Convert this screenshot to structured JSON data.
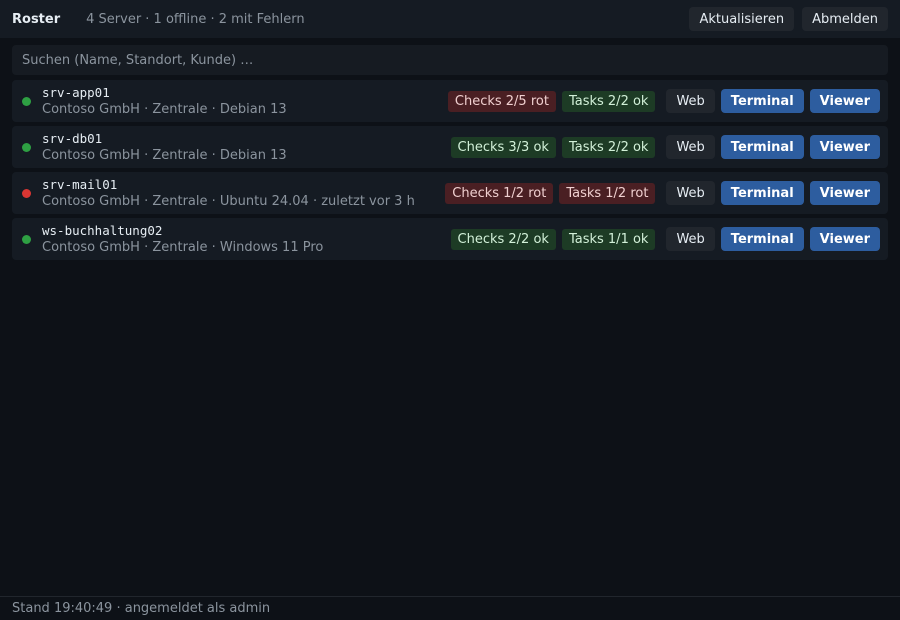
{
  "header": {
    "title": "Roster",
    "summary": "4 Server · 1 offline · 2 mit Fehlern",
    "refresh_label": "Aktualisieren",
    "logout_label": "Abmelden"
  },
  "search": {
    "placeholder": "Suchen (Name, Standort, Kunde) …"
  },
  "servers": [
    {
      "name": "srv-app01",
      "meta": "Contoso GmbH · Zentrale · Debian 13",
      "status": "online",
      "checks": {
        "label": "Checks 2/5 rot",
        "tone": "red"
      },
      "tasks": {
        "label": "Tasks 2/2 ok",
        "tone": "green"
      }
    },
    {
      "name": "srv-db01",
      "meta": "Contoso GmbH · Zentrale · Debian 13",
      "status": "online",
      "checks": {
        "label": "Checks 3/3 ok",
        "tone": "green"
      },
      "tasks": {
        "label": "Tasks 2/2 ok",
        "tone": "green"
      }
    },
    {
      "name": "srv-mail01",
      "meta": "Contoso GmbH · Zentrale · Ubuntu 24.04 · zuletzt vor 3 h",
      "status": "offline",
      "checks": {
        "label": "Checks 1/2 rot",
        "tone": "red"
      },
      "tasks": {
        "label": "Tasks 1/2 rot",
        "tone": "red"
      }
    },
    {
      "name": "ws-buchhaltung02",
      "meta": "Contoso GmbH · Zentrale · Windows 11 Pro",
      "status": "online",
      "checks": {
        "label": "Checks 2/2 ok",
        "tone": "green"
      },
      "tasks": {
        "label": "Tasks 1/1 ok",
        "tone": "green"
      }
    }
  ],
  "actions": {
    "web": "Web",
    "terminal": "Terminal",
    "viewer": "Viewer"
  },
  "footer": {
    "status": "Stand 19:40:49 · angemeldet als admin"
  },
  "colors": {
    "online": "#2ea043",
    "offline": "#da3633",
    "accent": "#2d5d9f",
    "badge_red": "#4a1f23",
    "badge_green": "#1d3b25"
  }
}
